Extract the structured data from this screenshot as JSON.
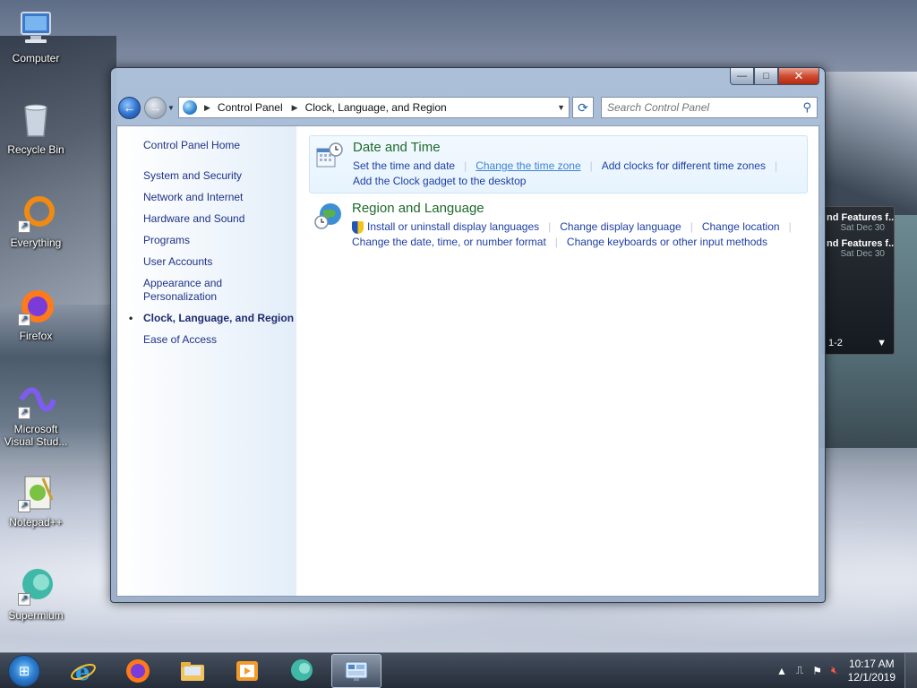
{
  "desktop": {
    "icons": [
      {
        "label": "Computer"
      },
      {
        "label": "Recycle Bin"
      },
      {
        "label": "Everything"
      },
      {
        "label": "Firefox"
      },
      {
        "label": "Microsoft Visual Stud..."
      },
      {
        "label": "Notepad++"
      },
      {
        "label": "Supermium"
      }
    ],
    "gadget": {
      "feeds": [
        {
          "title": "nd Features f...",
          "date": "Sat Dec 30"
        },
        {
          "title": "nd Features f...",
          "date": "Sat Dec 30"
        }
      ],
      "pager": "1-2",
      "pager_arrow": "▼"
    }
  },
  "window": {
    "controls": {
      "minimize": "—",
      "maximize": "□",
      "close": "✕"
    },
    "nav": {
      "back": "←",
      "forward": "→",
      "crumbs": [
        "Control Panel",
        "Clock, Language, and Region"
      ],
      "search_placeholder": "Search Control Panel"
    },
    "sidebar": {
      "home": "Control Panel Home",
      "items": [
        {
          "label": "System and Security",
          "active": false
        },
        {
          "label": "Network and Internet",
          "active": false
        },
        {
          "label": "Hardware and Sound",
          "active": false
        },
        {
          "label": "Programs",
          "active": false
        },
        {
          "label": "User Accounts",
          "active": false
        },
        {
          "label": "Appearance and Personalization",
          "active": false
        },
        {
          "label": "Clock, Language, and Region",
          "active": true
        },
        {
          "label": "Ease of Access",
          "active": false
        }
      ]
    },
    "sections": [
      {
        "title": "Date and Time",
        "links": [
          "Set the time and date",
          "Change the time zone",
          "Add clocks for different time zones",
          "Add the Clock gadget to the desktop"
        ]
      },
      {
        "title": "Region and Language",
        "links": [
          "Install or uninstall display languages",
          "Change display language",
          "Change location",
          "Change the date, time, or number format",
          "Change keyboards or other input methods"
        ]
      }
    ]
  },
  "taskbar": {
    "tray_arrow": "▲",
    "time": "10:17 AM",
    "date": "12/1/2019"
  }
}
